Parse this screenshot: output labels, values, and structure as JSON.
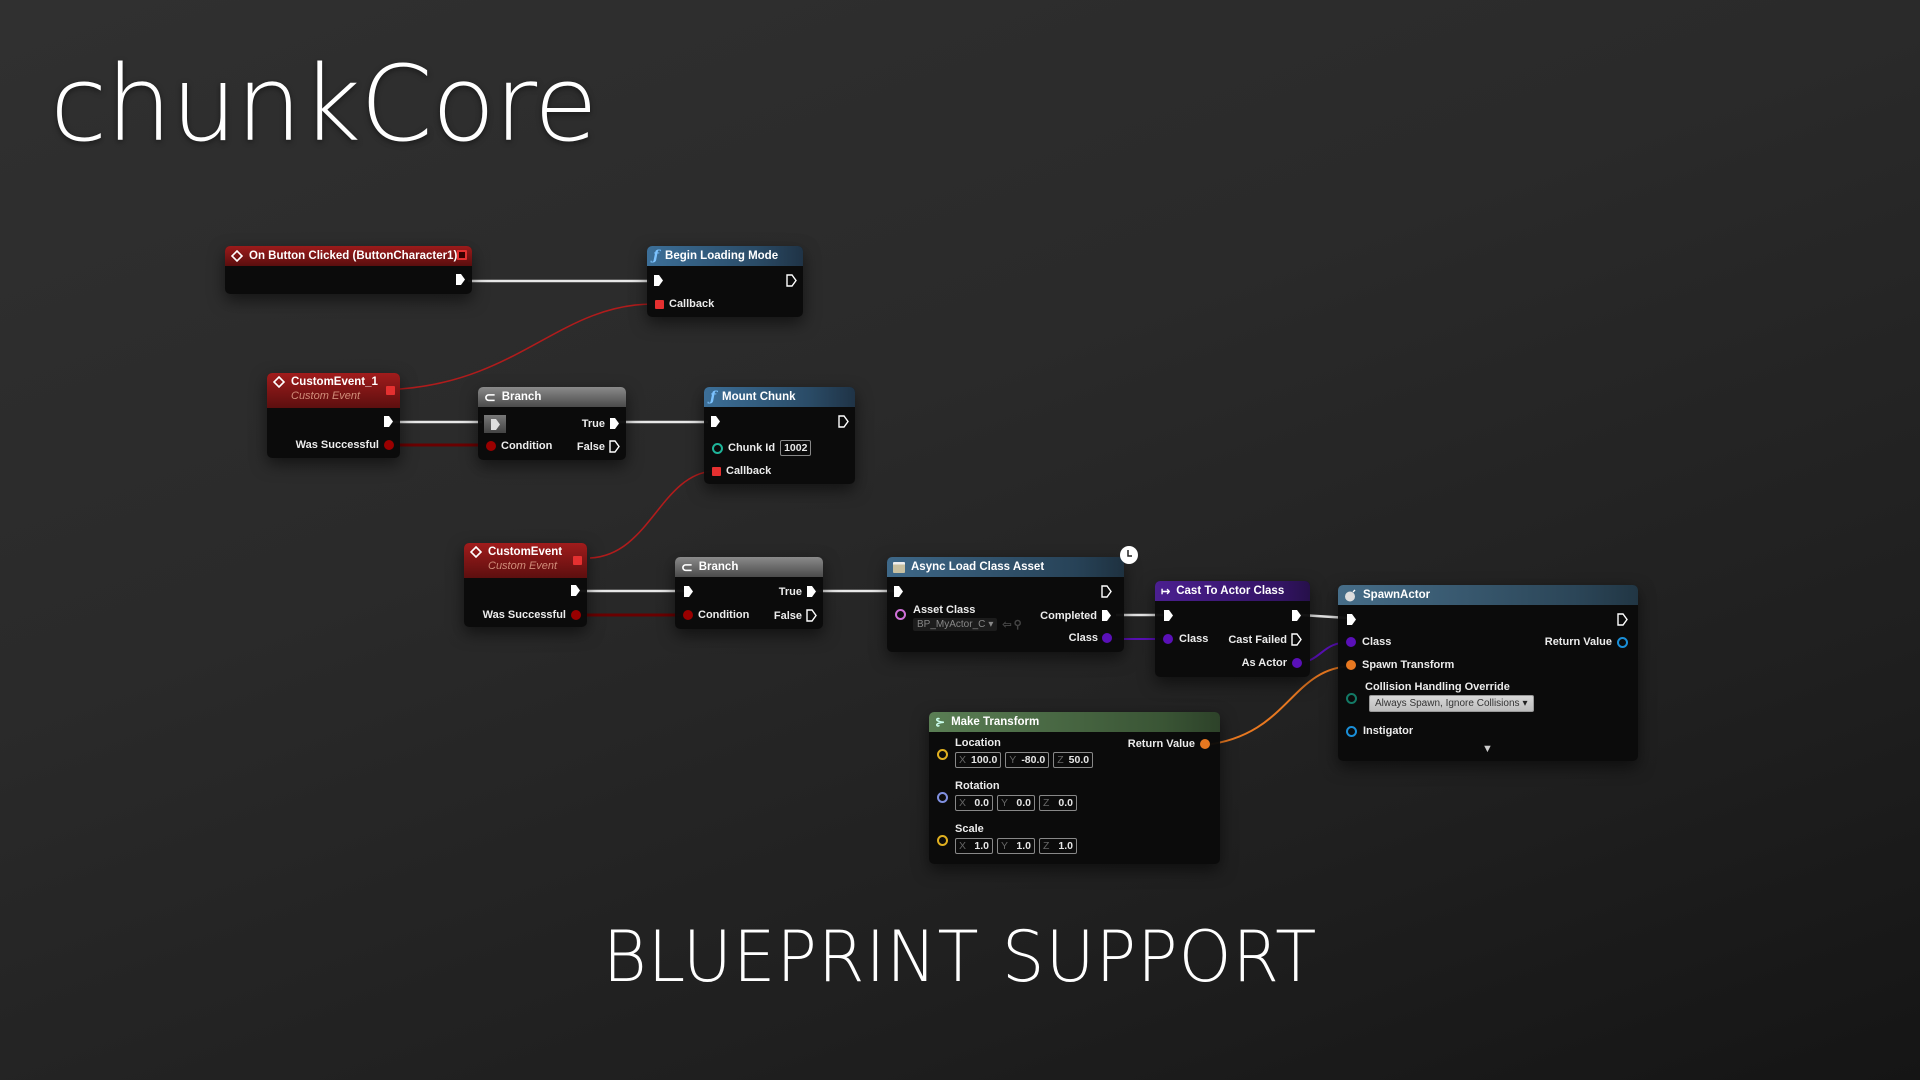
{
  "title": "chunkCore",
  "footer": "BLUEPRINT SUPPORT",
  "colors": {
    "exec_wire": "#e8e8e8",
    "delegate_wire": "#b01c1c",
    "bool_wire": "#6a0000",
    "class_wire": "#5a10b8",
    "transform_wire": "#e87820",
    "event_header": "#9c1b1b",
    "function_header": "#3c6f98",
    "branch_header": "#8a8a8a",
    "cast_header": "#4b1f90",
    "make_header": "#5a7e54"
  },
  "nodes": {
    "on_button_clicked": {
      "title": "On Button Clicked (ButtonCharacter1)",
      "icon": "event-diamond-icon"
    },
    "begin_loading_mode": {
      "title": "Begin Loading Mode",
      "icon": "function-icon",
      "pins": {
        "callback": "Callback"
      }
    },
    "custom_event_1": {
      "title": "CustomEvent_1",
      "subtitle": "Custom Event",
      "icon": "event-diamond-icon",
      "pins": {
        "was_successful": "Was Successful"
      }
    },
    "branch_1": {
      "title": "Branch",
      "icon": "branch-icon",
      "pins": {
        "condition": "Condition",
        "true": "True",
        "false": "False"
      }
    },
    "mount_chunk": {
      "title": "Mount Chunk",
      "icon": "function-icon",
      "pins": {
        "chunk_id": "Chunk Id",
        "chunk_id_value": "1002",
        "callback": "Callback"
      }
    },
    "custom_event": {
      "title": "CustomEvent",
      "subtitle": "Custom Event",
      "icon": "event-diamond-icon",
      "pins": {
        "was_successful": "Was Successful"
      }
    },
    "branch_2": {
      "title": "Branch",
      "icon": "branch-icon",
      "pins": {
        "condition": "Condition",
        "true": "True",
        "false": "False"
      }
    },
    "async_load": {
      "title": "Async Load Class Asset",
      "icon": "async-icon",
      "pins": {
        "asset_class": "Asset Class",
        "asset_class_value": "BP_MyActor_C",
        "completed": "Completed",
        "class": "Class"
      }
    },
    "cast_to_actor": {
      "title": "Cast To Actor Class",
      "icon": "cast-arrow-icon",
      "pins": {
        "class": "Class",
        "cast_failed": "Cast Failed",
        "as_actor": "As Actor"
      }
    },
    "spawn_actor": {
      "title": "SpawnActor",
      "icon": "spawn-bomb-icon",
      "pins": {
        "class": "Class",
        "return_value": "Return Value",
        "spawn_transform": "Spawn Transform",
        "collision": "Collision Handling Override",
        "collision_value": "Always Spawn, Ignore Collisions",
        "instigator": "Instigator"
      }
    },
    "make_transform": {
      "title": "Make Transform",
      "icon": "make-struct-icon",
      "return_value": "Return Value",
      "location": {
        "label": "Location",
        "x": "100.0",
        "y": "-80.0",
        "z": "50.0"
      },
      "rotation": {
        "label": "Rotation",
        "x": "0.0",
        "y": "0.0",
        "z": "0.0"
      },
      "scale": {
        "label": "Scale",
        "x": "1.0",
        "y": "1.0",
        "z": "1.0"
      },
      "axis_labels": {
        "x": "X",
        "y": "Y",
        "z": "Z"
      }
    }
  }
}
